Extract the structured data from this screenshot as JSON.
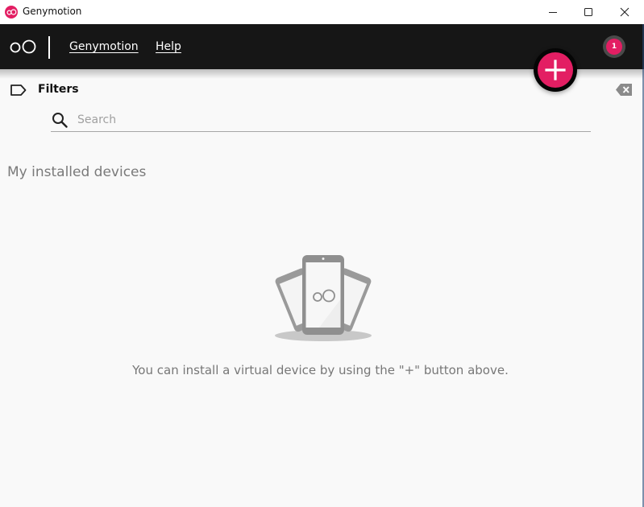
{
  "window": {
    "title": "Genymotion",
    "controls": {
      "minimize": "minimize-icon",
      "maximize": "maximize-icon",
      "close": "close-icon"
    }
  },
  "toolbar": {
    "logo": "oO",
    "menu": [
      {
        "label": "Genymotion",
        "mnemonic": "G"
      },
      {
        "label": "Help",
        "mnemonic": "H"
      }
    ],
    "notification_count": "1",
    "add_button_icon": "plus-icon"
  },
  "filters": {
    "label": "Filters",
    "search_placeholder": "Search",
    "search_value": "",
    "clear_icon": "backspace-clear-icon"
  },
  "main": {
    "section_title": "My installed devices",
    "empty_state": {
      "illustration": "phones-illustration",
      "message": "You can install a virtual device by using the \"+\" button above."
    }
  },
  "colors": {
    "accent": "#e31e63",
    "toolbar_bg": "#161616",
    "content_bg": "#f9f9f9",
    "muted_text": "#777777"
  }
}
